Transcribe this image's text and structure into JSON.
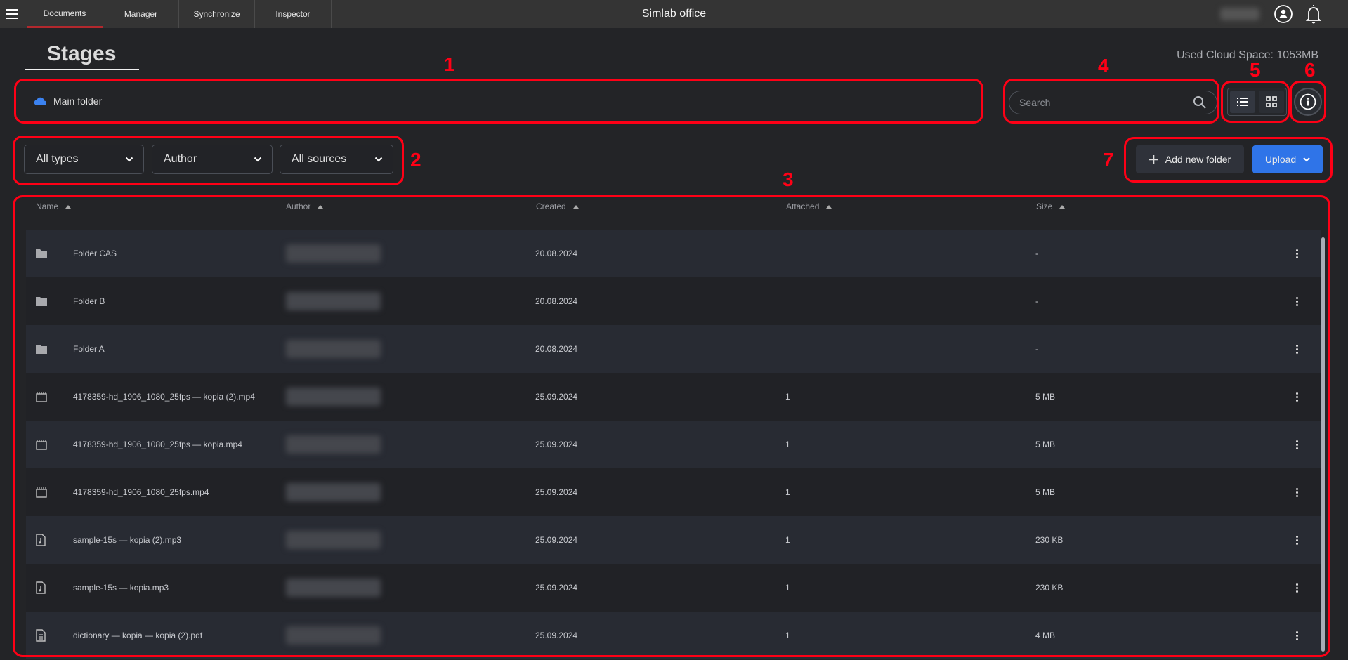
{
  "topbar": {
    "tabs": [
      {
        "label": "Documents",
        "active": true
      },
      {
        "label": "Manager"
      },
      {
        "label": "Synchronize"
      },
      {
        "label": "Inspector"
      }
    ],
    "title": "Simlab office"
  },
  "page": {
    "title": "Stages",
    "used_space": "Used Cloud Space: 1053MB"
  },
  "breadcrumb": {
    "label": "Main folder"
  },
  "search": {
    "placeholder": "Search"
  },
  "filters": [
    {
      "label": "All types"
    },
    {
      "label": "Author"
    },
    {
      "label": "All sources"
    }
  ],
  "actions": {
    "add_folder": "Add new folder",
    "upload": "Upload"
  },
  "annotations": [
    "1",
    "2",
    "3",
    "4",
    "5",
    "6",
    "7"
  ],
  "colors": {
    "accent": "#2f74e8",
    "annotation": "#ff0016",
    "active_tab": "#b3282d"
  },
  "table": {
    "columns": [
      "Name",
      "Author",
      "Created",
      "Attached",
      "Size"
    ],
    "rows": [
      {
        "icon": "folder-icon",
        "name": "Folder  CAS",
        "created": "20.08.2024",
        "attached": "",
        "size": "-"
      },
      {
        "icon": "folder-icon",
        "name": "Folder B",
        "created": "20.08.2024",
        "attached": "",
        "size": "-"
      },
      {
        "icon": "folder-icon",
        "name": "Folder A",
        "created": "20.08.2024",
        "attached": "",
        "size": "-"
      },
      {
        "icon": "video-icon",
        "name": "4178359-hd_1906_1080_25fps — kopia (2).mp4",
        "created": "25.09.2024",
        "attached": "1",
        "size": "5 MB"
      },
      {
        "icon": "video-icon",
        "name": "4178359-hd_1906_1080_25fps — kopia.mp4",
        "created": "25.09.2024",
        "attached": "1",
        "size": "5 MB"
      },
      {
        "icon": "video-icon",
        "name": "4178359-hd_1906_1080_25fps.mp4",
        "created": "25.09.2024",
        "attached": "1",
        "size": "5 MB"
      },
      {
        "icon": "audio-file-icon",
        "name": "sample-15s — kopia (2).mp3",
        "created": "25.09.2024",
        "attached": "1",
        "size": "230 KB"
      },
      {
        "icon": "audio-file-icon",
        "name": "sample-15s — kopia.mp3",
        "created": "25.09.2024",
        "attached": "1",
        "size": "230 KB"
      },
      {
        "icon": "document-icon",
        "name": "dictionary — kopia — kopia (2).pdf",
        "created": "25.09.2024",
        "attached": "1",
        "size": "4 MB"
      }
    ]
  }
}
